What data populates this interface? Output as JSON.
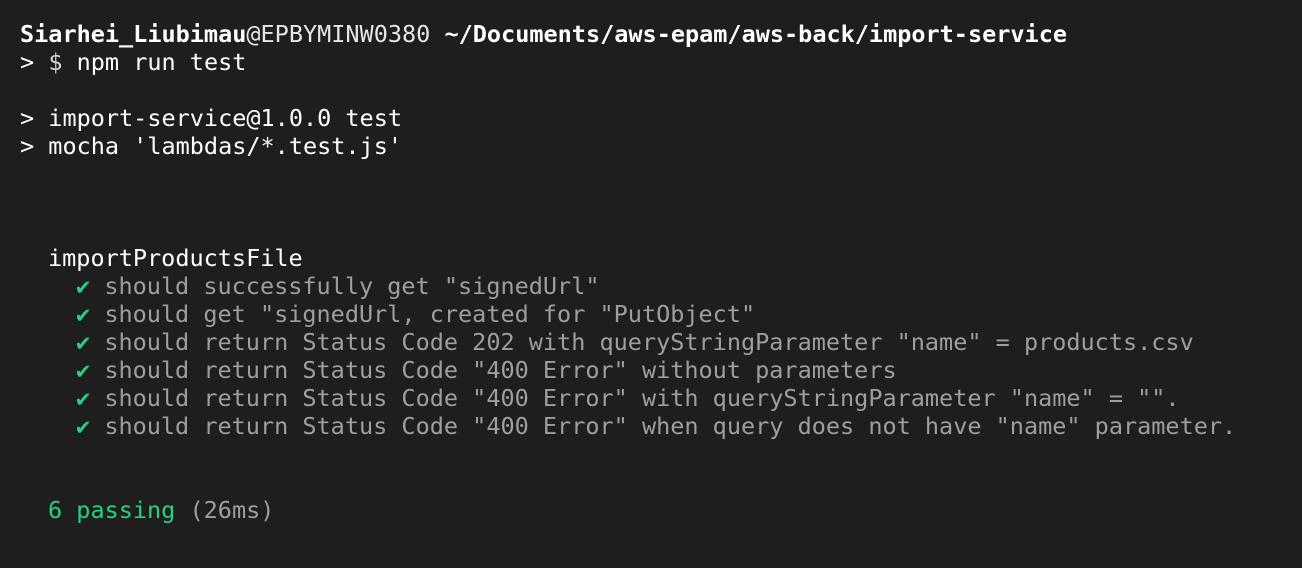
{
  "prompt": {
    "user": "Siarhei_Liubimau",
    "at_host": "@EPBYMINW0380",
    "cwd": "~/Documents/aws-epam/aws-back/import-service",
    "arrow": ">",
    "dollar": "$",
    "command": "npm run test"
  },
  "npm_output": [
    "> import-service@1.0.0 test",
    "> mocha 'lambdas/*.test.js'"
  ],
  "suite": {
    "name": "importProductsFile",
    "check_glyph": "✔",
    "tests": [
      "should successfully get \"signedUrl\"",
      "should get \"signedUrl, created for \"PutObject\"",
      "should return Status Code 202 with queryStringParameter \"name\" = products.csv",
      "should return Status Code \"400 Error\" without parameters",
      "should return Status Code \"400 Error\" with queryStringParameter \"name\" = \"\".",
      "should return Status Code \"400 Error\" when query does not have \"name\" parameter."
    ]
  },
  "summary": {
    "passing": "6 passing",
    "duration": "(26ms)"
  },
  "colors": {
    "background": "#1e1e1e",
    "pass_green": "#23d18b",
    "dim_text": "#9e9e9e"
  }
}
